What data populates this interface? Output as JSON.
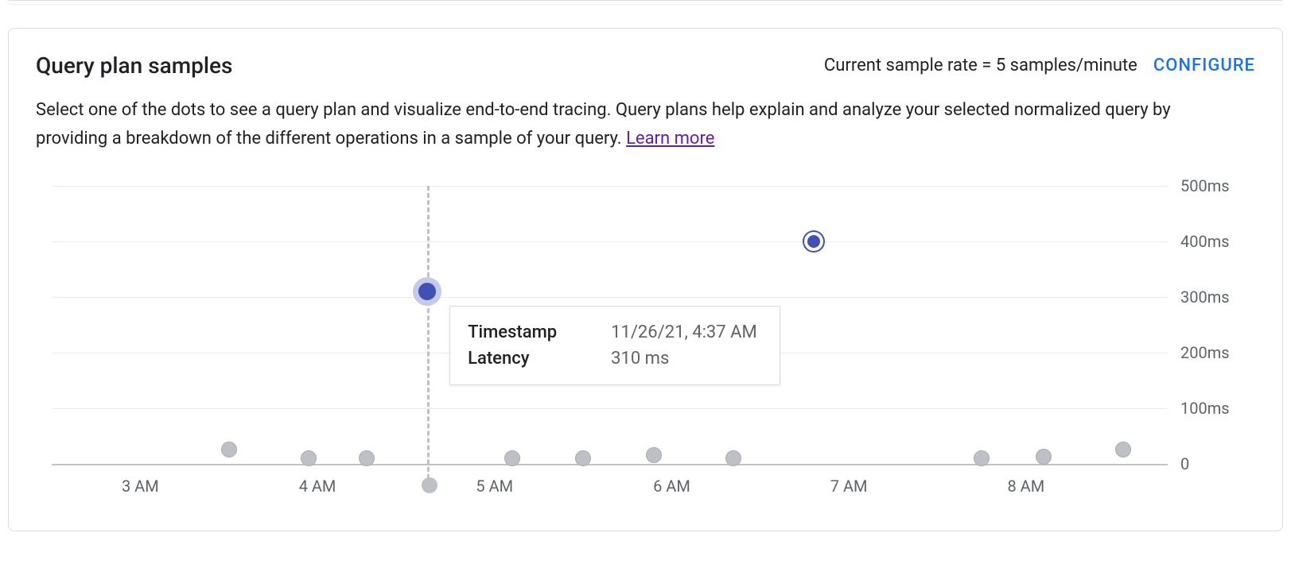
{
  "header": {
    "title": "Query plan samples",
    "sample_rate_text": "Current sample rate = 5 samples/minute",
    "configure_label": "CONFIGURE"
  },
  "description": {
    "text": "Select one of the dots to see a query plan and visualize end-to-end tracing. Query plans help explain and analyze your selected normalized query by providing a breakdown of the different operations in a sample of your query. ",
    "learn_more": "Learn more"
  },
  "tooltip": {
    "timestamp_label": "Timestamp",
    "timestamp_value": "11/26/21, 4:37 AM",
    "latency_label": "Latency",
    "latency_value": "310 ms"
  },
  "chart_data": {
    "type": "scatter",
    "title": "Query plan samples latency",
    "xlabel": "",
    "ylabel": "",
    "x_range_hours": [
      2.5,
      8.8
    ],
    "ylim": [
      0,
      500
    ],
    "y_ticks": [
      0,
      100,
      200,
      300,
      400,
      500
    ],
    "y_tick_labels": [
      "0",
      "100ms",
      "200ms",
      "300ms",
      "400ms",
      "500ms"
    ],
    "x_ticks": [
      3,
      4,
      5,
      6,
      7,
      8
    ],
    "x_tick_labels": [
      "3 AM",
      "4 AM",
      "5 AM",
      "6 AM",
      "7 AM",
      "8 AM"
    ],
    "crosshair_x": 4.62,
    "hovered_index": 3,
    "selected_index": 8,
    "series": [
      {
        "name": "samples",
        "points": [
          {
            "x": 3.5,
            "y": 25,
            "latency_ms": 25
          },
          {
            "x": 3.95,
            "y": 10,
            "latency_ms": 10
          },
          {
            "x": 4.28,
            "y": 10,
            "latency_ms": 10
          },
          {
            "x": 4.62,
            "y": 310,
            "latency_ms": 310,
            "timestamp": "11/26/21, 4:37 AM"
          },
          {
            "x": 5.1,
            "y": 10,
            "latency_ms": 10
          },
          {
            "x": 5.5,
            "y": 10,
            "latency_ms": 10
          },
          {
            "x": 5.9,
            "y": 15,
            "latency_ms": 15
          },
          {
            "x": 6.35,
            "y": 10,
            "latency_ms": 10
          },
          {
            "x": 6.8,
            "y": 400,
            "latency_ms": 400
          },
          {
            "x": 7.75,
            "y": 10,
            "latency_ms": 10
          },
          {
            "x": 8.1,
            "y": 12,
            "latency_ms": 12
          },
          {
            "x": 8.55,
            "y": 25,
            "latency_ms": 25
          }
        ]
      }
    ]
  }
}
